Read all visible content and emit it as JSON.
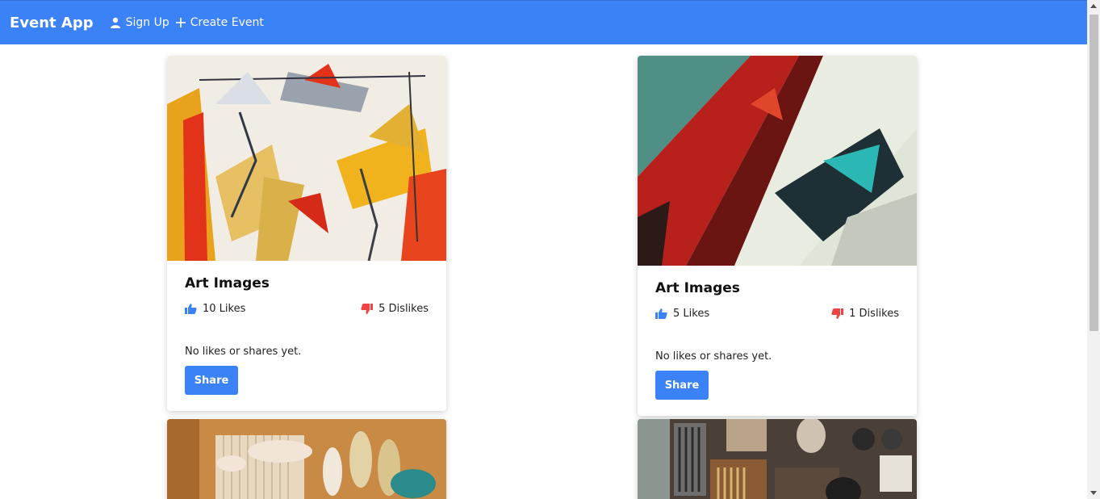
{
  "nav": {
    "brand": "Event App",
    "signup_label": "Sign Up",
    "create_label": "Create Event",
    "color": "#3b82f6"
  },
  "cards": [
    {
      "title": "Art Images",
      "likes": "10 Likes",
      "dislikes": "5 Dislikes",
      "note": "No likes or shares yet.",
      "share_label": "Share"
    },
    {
      "title": "Art Images",
      "likes": "5 Likes",
      "dislikes": "1 Dislikes",
      "note": "No likes or shares yet.",
      "share_label": "Share"
    }
  ],
  "icons": {
    "user": "user-icon",
    "plus": "plus-icon",
    "like": "thumbs-up-icon",
    "dislike": "thumbs-down-icon"
  },
  "colors": {
    "accent": "#3b82f6",
    "like": "#3b82f6",
    "dislike": "#ef4444"
  }
}
